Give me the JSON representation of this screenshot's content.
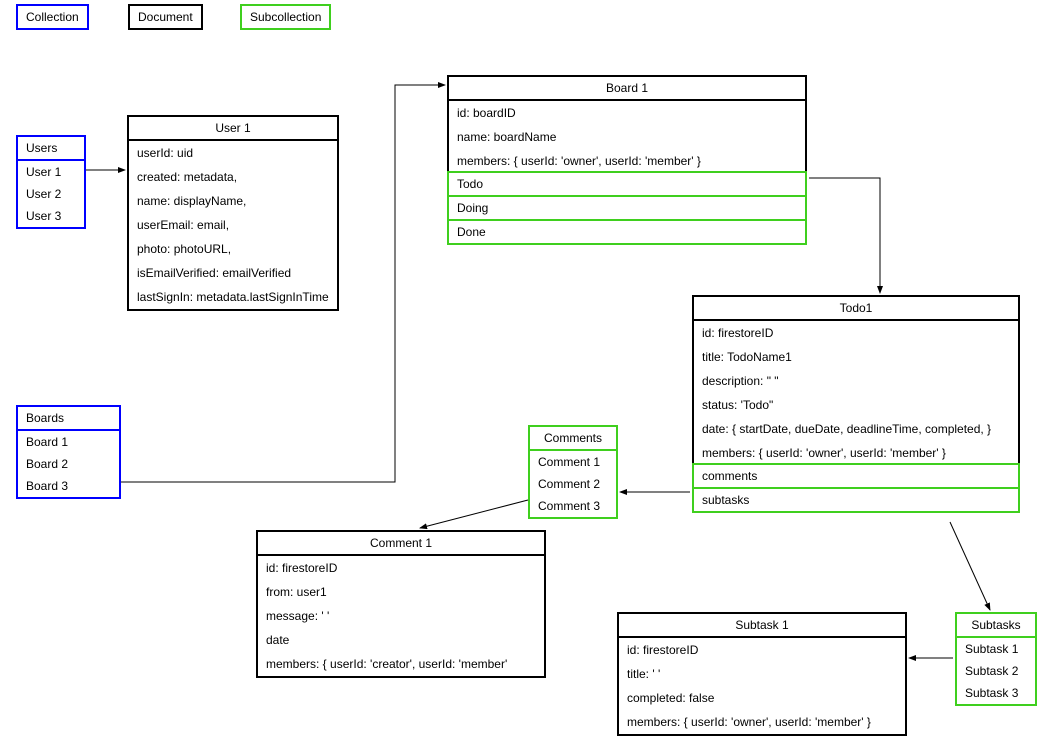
{
  "legend": {
    "collection": "Collection",
    "document": "Document",
    "subcollection": "Subcollection"
  },
  "users": {
    "title": "Users",
    "items": [
      "User 1",
      "User 2",
      "User 3"
    ]
  },
  "user1": {
    "title": "User 1",
    "fields": [
      "userId: uid",
      "created: metadata,",
      "name: displayName,",
      "userEmail: email,",
      "photo: photoURL,",
      "isEmailVerified: emailVerified",
      "lastSignIn: metadata.lastSignInTime"
    ]
  },
  "boards": {
    "title": "Boards",
    "items": [
      "Board 1",
      "Board 2",
      "Board 3"
    ]
  },
  "board1": {
    "title": "Board 1",
    "fields": [
      "id: boardID",
      "name: boardName",
      "members: { userId: 'owner', userId: 'member' }"
    ],
    "subcollections": [
      "Todo",
      "Doing",
      "Done"
    ]
  },
  "todo1": {
    "title": "Todo1",
    "fields": [
      "id: firestoreID",
      "title: TodoName1",
      "description: \" \"",
      "status: 'Todo\"",
      "date: { startDate, dueDate, deadlineTime, completed, }",
      "members: { userId: 'owner', userId: 'member' }"
    ],
    "subcollections": [
      "comments",
      "subtasks"
    ]
  },
  "comments": {
    "title": "Comments",
    "items": [
      "Comment 1",
      "Comment 2",
      "Comment 3"
    ]
  },
  "comment1": {
    "title": "Comment 1",
    "fields": [
      "id: firestoreID",
      "from: user1",
      "message: ' '",
      "date",
      "members: { userId: 'creator', userId: 'member'"
    ]
  },
  "subtasks": {
    "title": "Subtasks",
    "items": [
      "Subtask 1",
      "Subtask 2",
      "Subtask 3"
    ]
  },
  "subtask1": {
    "title": "Subtask 1",
    "fields": [
      "id: firestoreID",
      "title: ' '",
      "completed: false",
      "members: { userId: 'owner', userId: 'member' }"
    ]
  }
}
